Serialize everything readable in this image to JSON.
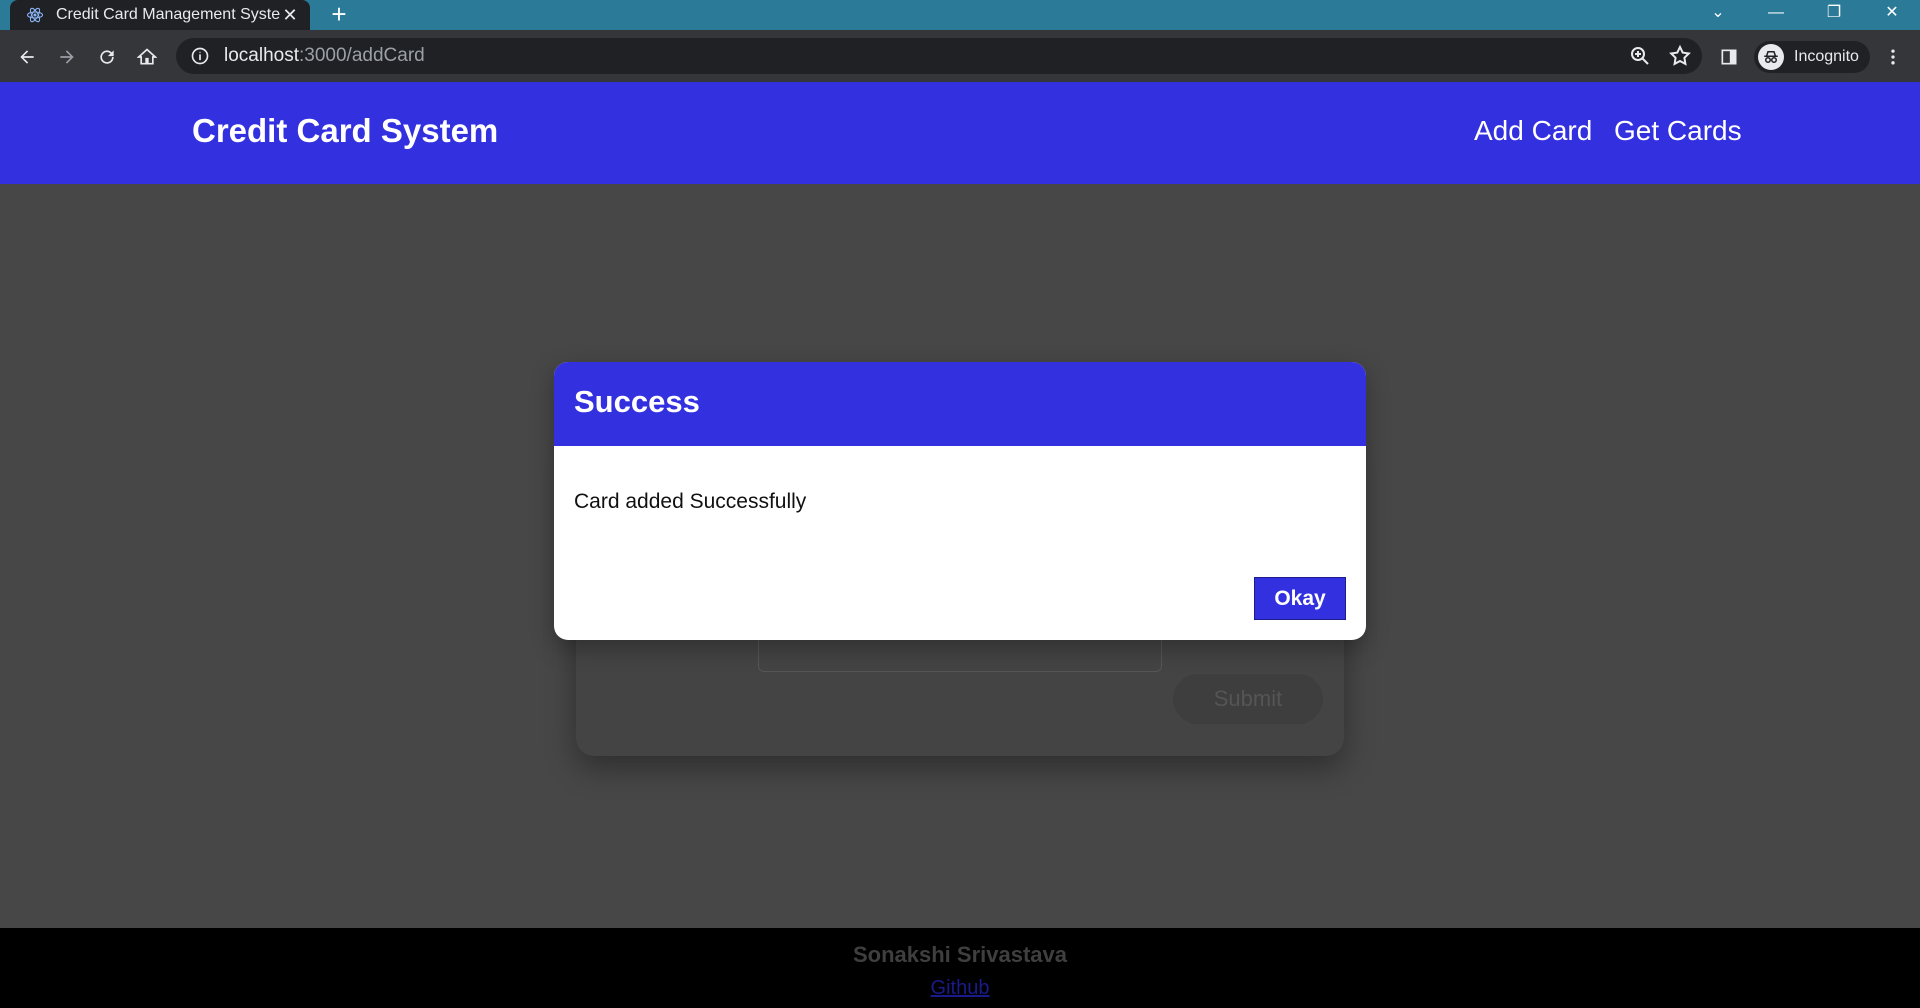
{
  "browser": {
    "tab_title": "Credit Card Management System",
    "url_host": "localhost",
    "url_path": ":3000/addCard",
    "profile_label": "Incognito"
  },
  "navbar": {
    "brand": "Credit Card System",
    "links": [
      "Add Card",
      "Get Cards"
    ],
    "color": "#3330e0"
  },
  "form": {
    "submit_label": "Submit"
  },
  "modal": {
    "title": "Success",
    "message": "Card added Successfully",
    "okay_label": "Okay"
  },
  "footer": {
    "author": "Sonakshi Srivastava",
    "link": "Github"
  }
}
